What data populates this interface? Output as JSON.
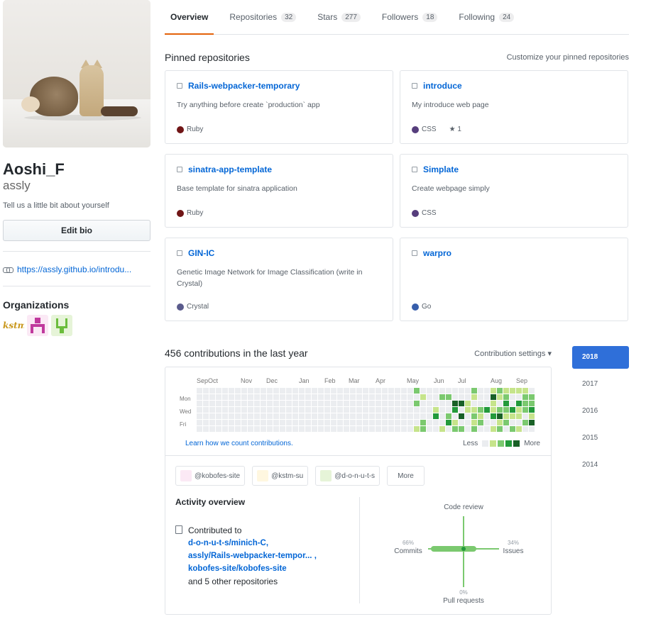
{
  "profile": {
    "name": "Aoshi_F",
    "login": "assly",
    "bio_hint": "Tell us a little bit about yourself",
    "edit_bio": "Edit bio",
    "website": "https://assly.github.io/introdu...",
    "organizations_title": "Organizations"
  },
  "tabs": [
    {
      "label": "Overview",
      "count": ""
    },
    {
      "label": "Repositories",
      "count": "32"
    },
    {
      "label": "Stars",
      "count": "277"
    },
    {
      "label": "Followers",
      "count": "18"
    },
    {
      "label": "Following",
      "count": "24"
    }
  ],
  "pinned": {
    "title": "Pinned repositories",
    "customize": "Customize your pinned repositories",
    "repos": [
      {
        "name": "Rails-webpacker-temporary",
        "desc": "Try anything before create `production` app",
        "lang": "Ruby",
        "lang_color": "#701516",
        "stars": ""
      },
      {
        "name": "introduce",
        "desc": "My introduce web page",
        "lang": "CSS",
        "lang_color": "#563d7c",
        "stars": "1"
      },
      {
        "name": "sinatra-app-template",
        "desc": "Base template for sinatra application",
        "lang": "Ruby",
        "lang_color": "#701516",
        "stars": ""
      },
      {
        "name": "Simplate",
        "desc": "Create webpage simply",
        "lang": "CSS",
        "lang_color": "#563d7c",
        "stars": ""
      },
      {
        "name": "GIN-IC",
        "desc": "Genetic Image Network for Image Classification (write in Crystal)",
        "lang": "Crystal",
        "lang_color": "#5a5b8c",
        "stars": ""
      },
      {
        "name": "warpro",
        "desc": "",
        "lang": "Go",
        "lang_color": "#375eab",
        "stars": ""
      }
    ]
  },
  "contributions": {
    "title": "456 contributions in the last year",
    "settings": "Contribution settings ▾",
    "months": [
      "Sep",
      "Oct",
      "Nov",
      "Dec",
      "Jan",
      "Feb",
      "Mar",
      "Apr",
      "May",
      "Jun",
      "Jul",
      "Aug",
      "Sep"
    ],
    "days": [
      "Mon",
      "Wed",
      "Fri"
    ],
    "learn": "Learn how we count contributions.",
    "less": "Less",
    "more": "More",
    "colors": [
      "#ebedf0",
      "#c6e48b",
      "#7bc96f",
      "#239a3b",
      "#196127"
    ]
  },
  "org_filters": [
    {
      "label": "@kobofes-site"
    },
    {
      "label": "@kstm-su"
    },
    {
      "label": "@d-o-n-u-t-s"
    },
    {
      "label": "More"
    }
  ],
  "activity": {
    "title": "Activity overview",
    "contributed_to": "Contributed to",
    "repos": [
      "d-o-n-u-t-s/minich-C,",
      "assly/Rails-webpacker-tempor... ,",
      "kobofes-site/kobofes-site"
    ],
    "other": "and 5 other repositories",
    "radar": {
      "code_review_label": "Code review",
      "commits_label": "Commits",
      "commits_pct": "66%",
      "issues_label": "Issues",
      "issues_pct": "34%",
      "pulls_label": "Pull requests",
      "pulls_pct": "0%",
      "color": "#7bc96f"
    }
  },
  "years": [
    "2018",
    "2017",
    "2016",
    "2015",
    "2014"
  ]
}
